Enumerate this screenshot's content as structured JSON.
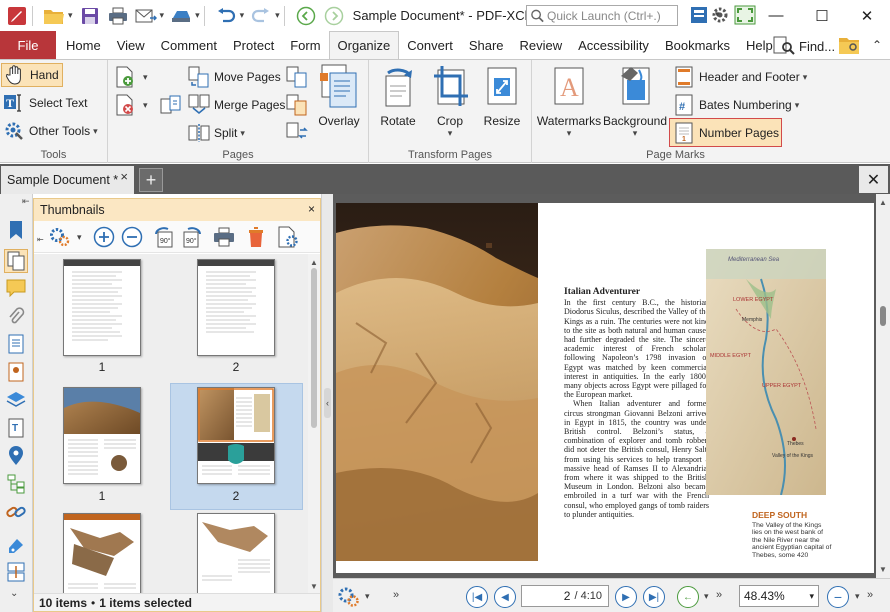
{
  "window": {
    "title": "Sample Document* - PDF-XCh...",
    "quick_launch_placeholder": "Quick Launch (Ctrl+.)",
    "minimize": "—",
    "maximize": "☐",
    "close": "✕"
  },
  "menu": {
    "file": "File",
    "tabs": [
      "Home",
      "View",
      "Comment",
      "Protect",
      "Form",
      "Organize",
      "Convert",
      "Share",
      "Review",
      "Accessibility",
      "Bookmarks",
      "Help"
    ],
    "active_tab": "Organize",
    "find": "Find..."
  },
  "ribbon": {
    "tools": {
      "label": "Tools",
      "hand": "Hand",
      "select_text": "Select Text",
      "other_tools": "Other Tools"
    },
    "pages": {
      "label": "Pages",
      "move_pages": "Move Pages",
      "merge_pages": "Merge Pages",
      "split": "Split",
      "overlay": "Overlay"
    },
    "transform_pages": {
      "label": "Transform Pages",
      "rotate": "Rotate",
      "crop": "Crop",
      "resize": "Resize"
    },
    "page_marks": {
      "label": "Page Marks",
      "watermarks": "Watermarks",
      "background": "Background",
      "header_footer": "Header and Footer",
      "bates_numbering": "Bates Numbering",
      "number_pages": "Number Pages"
    }
  },
  "doc_tab": {
    "name": "Sample Document *",
    "close": "×",
    "new": "+",
    "close_all": "✕"
  },
  "thumbnails": {
    "title": "Thumbnails",
    "close": "×",
    "labels": [
      "1",
      "2",
      "1",
      "2"
    ],
    "status_count": "10 items",
    "status_selected": "1 items selected",
    "status_sep": "•"
  },
  "document": {
    "article_title": "Italian Adventurer",
    "para1": "In the first century B.C., the historian Diodorus Siculus, described the Valley of the Kings as a ruin. The centuries were not kind to the site as both natural and human causes had further degraded the site. The sincere academic interest of French scholars following Napoleon’s 1798 invasion of Egypt was matched by keen commercial interest in antiquities. In the early 1800s many objects across Egypt were pillaged for the European market.",
    "para2": "When Italian adventurer and former circus strongman Giovanni Belzoni arrived in Egypt in 1815, the country was under British control. Belzoni’s status, a combination of explorer and tomb robber, did not deter the British consul, Henry Salt, from using his services to help transport a massive head of Ramses II to Alexandria, from where it was shipped to the British Museum in London. Belzoni also became embroiled in a turf war with the French consul, who employed gangs of tomb raiders to plunder antiquities.",
    "side_title": "DEEP SOUTH",
    "side_text": "The Valley of the Kings lies on the west bank of the Nile River near the ancient Egyptian capital of Thebes, some 420",
    "map_title": "Mediterranean Sea",
    "map_labels": [
      "LOWER EGYPT",
      "Memphis",
      "MIDDLE EGYPT",
      "UPPER EGYPT",
      "Thebes",
      "Valley of the Kings"
    ]
  },
  "bottom": {
    "current_page": "2",
    "total_pages": "/ 4:10",
    "zoom": "48.43%"
  },
  "colors": {
    "file_tab": "#b8363a",
    "accent_blue": "#2f6fb3",
    "panel_header": "#fbe7c3",
    "highlight": "#fbe3b8"
  }
}
